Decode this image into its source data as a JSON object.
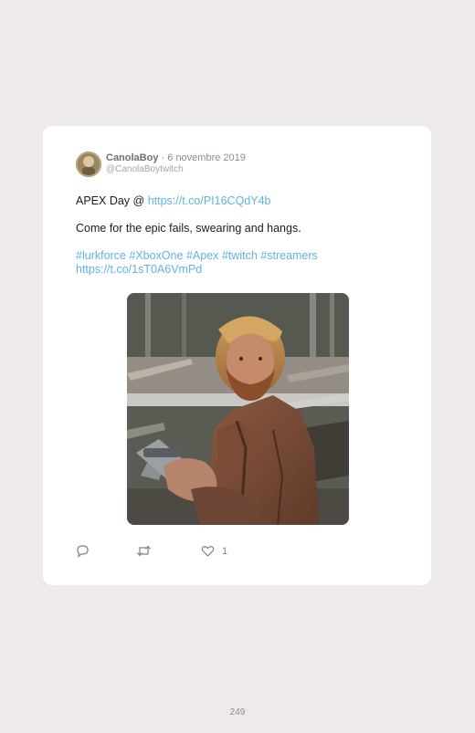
{
  "tweet": {
    "author_name": "CanolaBoy",
    "separator": "·",
    "date": "6 novembre 2019",
    "handle": "@CanolaBoytwitch",
    "line1_text": "APEX Day @",
    "line1_link": "https://t.co/PI16CQdY4b",
    "line2_text": "Come for the epic fails, swearing and hangs.",
    "hashtags": [
      "#lurkforce",
      "#XboxOne",
      "#Apex",
      "#twitch",
      "#streamers"
    ],
    "line4_link": "https://t.co/1sT0A6VmPd",
    "like_count": "1"
  },
  "icons": {
    "reply": "reply-icon",
    "retweet": "retweet-icon",
    "like": "heart-icon"
  },
  "colors": {
    "background": "#eeeaea",
    "card": "#ffffff",
    "link": "#5fb4e3",
    "muted": "#8a8f94"
  },
  "page": {
    "number": "249"
  }
}
